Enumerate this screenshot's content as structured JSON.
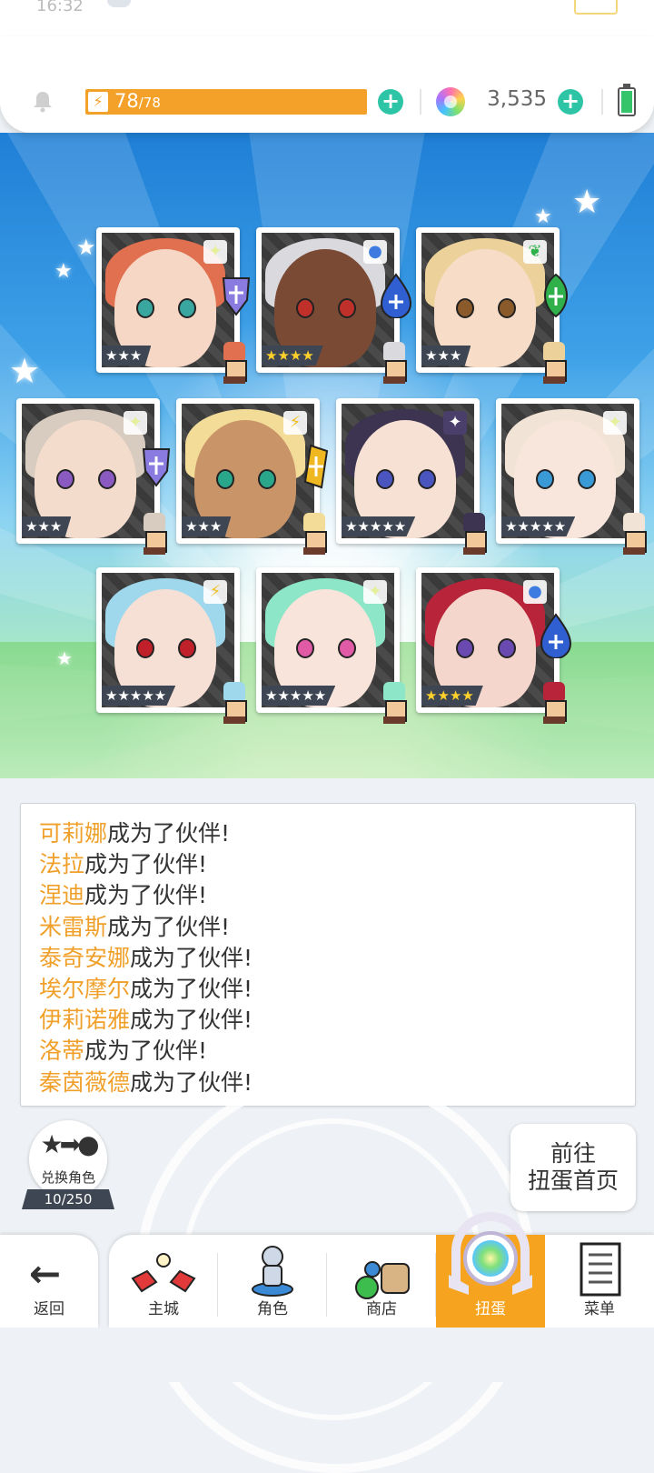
{
  "status": {
    "time": "16:32"
  },
  "resources": {
    "energy_current": "78",
    "energy_max": "/78",
    "energy_fill": 1.0,
    "gems": "3,535"
  },
  "cards": [
    {
      "stars": "★★★",
      "rarity": "silver",
      "element": "light",
      "hair": "#e0704f",
      "face": "#f6d6c4",
      "eye": "#3aa6a0",
      "weapon": "shield"
    },
    {
      "stars": "★★★★",
      "rarity": "gold",
      "element": "water",
      "hair": "#d9d9de",
      "face": "#7a4a34",
      "eye": "#c0302a",
      "weapon": "droplet"
    },
    {
      "stars": "★★★",
      "rarity": "silver",
      "element": "earth",
      "hair": "#ecd29a",
      "face": "#f7dcc8",
      "eye": "#8b5a2a",
      "weapon": "leaf"
    },
    {
      "stars": "★★★",
      "rarity": "silver",
      "element": "light",
      "hair": "#d8cbbf",
      "face": "#f4dccd",
      "eye": "#8a5ac0",
      "weapon": "shield"
    },
    {
      "stars": "★★★",
      "rarity": "silver",
      "element": "basic",
      "hair": "#f2dc98",
      "face": "#c99468",
      "eye": "#2aa68a",
      "weapon": "crystal"
    },
    {
      "stars": "★★★★★",
      "rarity": "silver",
      "element": "dark",
      "hair": "#3c3450",
      "face": "#f7e0d4",
      "eye": "#4a55c0",
      "weapon": "none"
    },
    {
      "stars": "★★★★★",
      "rarity": "silver",
      "element": "light",
      "hair": "#f1e4d6",
      "face": "#f8e6dc",
      "eye": "#3a9ad6",
      "weapon": "none"
    },
    {
      "stars": "★★★★★",
      "rarity": "silver",
      "element": "basic",
      "hair": "#9fd8ec",
      "face": "#f6e0d6",
      "eye": "#c0202a",
      "weapon": "none"
    },
    {
      "stars": "★★★★★",
      "rarity": "silver",
      "element": "light",
      "hair": "#8ee6c8",
      "face": "#f8e4da",
      "eye": "#e05aa6",
      "weapon": "none"
    },
    {
      "stars": "★★★★",
      "rarity": "gold",
      "element": "water",
      "hair": "#b8243a",
      "face": "#f4d6cc",
      "eye": "#6a4ab0",
      "weapon": "droplet"
    }
  ],
  "log": [
    {
      "name": "可莉娜",
      "text": "成为了伙伴!"
    },
    {
      "name": "法拉",
      "text": "成为了伙伴!"
    },
    {
      "name": "涅迪",
      "text": "成为了伙伴!"
    },
    {
      "name": "米雷斯",
      "text": "成为了伙伴!"
    },
    {
      "name": "泰奇安娜",
      "text": "成为了伙伴!"
    },
    {
      "name": "埃尔摩尔",
      "text": "成为了伙伴!"
    },
    {
      "name": "伊莉诺雅",
      "text": "成为了伙伴!"
    },
    {
      "name": "洛蒂",
      "text": "成为了伙伴!"
    },
    {
      "name": "秦茵薇德",
      "text": "成为了伙伴!"
    }
  ],
  "exchange": {
    "label": "兑换角色",
    "count": "10/250"
  },
  "goto": {
    "line1": "前往",
    "line2": "扭蛋首页"
  },
  "nav": {
    "back": "返回",
    "tabs": [
      {
        "id": "town",
        "label": "主城",
        "icon": "town-icon",
        "active": false
      },
      {
        "id": "hero",
        "label": "角色",
        "icon": "hero-icon",
        "active": false
      },
      {
        "id": "shop",
        "label": "商店",
        "icon": "shop-icon",
        "active": false
      },
      {
        "id": "gacha",
        "label": "扭蛋",
        "icon": "gacha-icon",
        "active": true
      },
      {
        "id": "menu",
        "label": "菜单",
        "icon": "menu-icon",
        "active": false
      }
    ]
  },
  "colors": {
    "accent": "#f6a31f",
    "plus": "#2ec4a6",
    "name": "#f0a02a"
  }
}
